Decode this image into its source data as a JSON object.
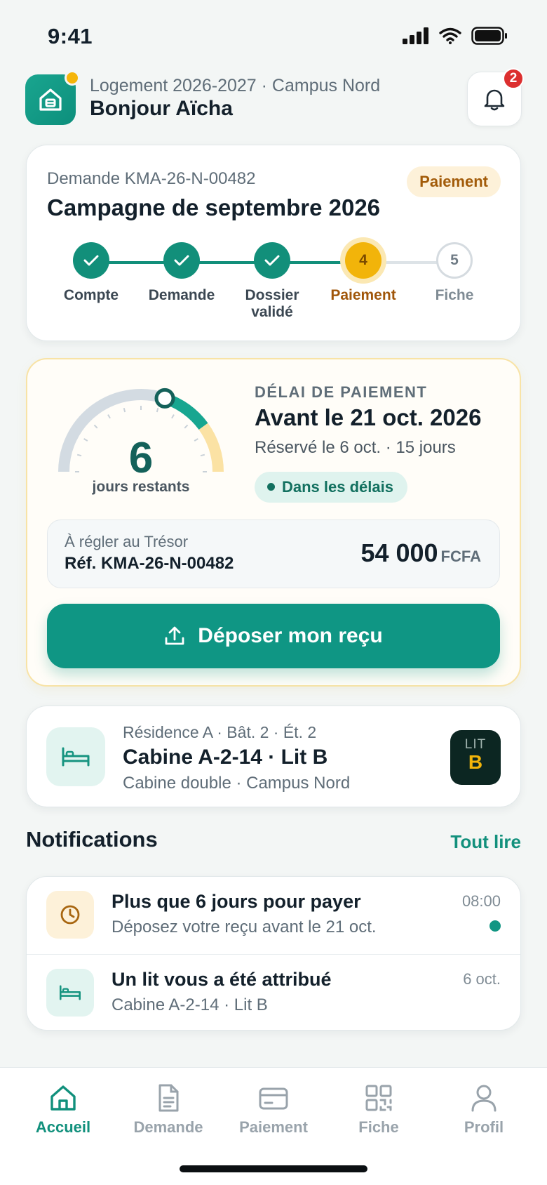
{
  "status_bar": {
    "time": "9:41"
  },
  "header": {
    "subtitle": "Logement 2026-2027 · Campus Nord",
    "greeting": "Bonjour Aïcha",
    "notification_count": "2"
  },
  "request": {
    "id_label": "Demande KMA-26-N-00482",
    "title": "Campagne de septembre 2026",
    "badge": "Paiement",
    "steps": [
      {
        "label": "Compte",
        "state": "done"
      },
      {
        "label": "Demande",
        "state": "done"
      },
      {
        "label": "Dossier validé",
        "state": "done"
      },
      {
        "label": "Paiement",
        "state": "current",
        "number": "4"
      },
      {
        "label": "Fiche",
        "state": "todo",
        "number": "5"
      }
    ]
  },
  "payment": {
    "days_remaining": "6",
    "days_label": "jours restants",
    "days_total": 15,
    "eyebrow": "DÉLAI DE PAIEMENT",
    "deadline": "Avant le 21 oct. 2026",
    "reserved": "Réservé le 6 oct. · 15 jours",
    "status": "Dans les délais",
    "pay_to_label": "À régler au Trésor",
    "reference": "Réf. KMA-26-N-00482",
    "amount": "54 000",
    "currency": "FCFA",
    "upload_button": "Déposer mon reçu"
  },
  "bed": {
    "residence": "Résidence A · Bât. 2 · Ét. 2",
    "title": "Cabine A-2-14 · Lit B",
    "type": "Cabine double · Campus Nord",
    "badge_label": "LIT",
    "badge_letter": "B"
  },
  "notifications": {
    "heading": "Notifications",
    "read_all": "Tout lire",
    "items": [
      {
        "title": "Plus que 6 jours pour payer",
        "text": "Déposez votre reçu avant le 21 oct.",
        "time": "08:00",
        "icon": "clock-icon",
        "unread": true
      },
      {
        "title": "Un lit vous a été attribué",
        "text": "Cabine A-2-14 · Lit B",
        "time": "6 oct.",
        "icon": "bed-icon",
        "unread": false
      }
    ]
  },
  "tabs": [
    {
      "label": "Accueil",
      "icon": "home-icon",
      "active": true
    },
    {
      "label": "Demande",
      "icon": "document-icon",
      "active": false
    },
    {
      "label": "Paiement",
      "icon": "card-icon",
      "active": false
    },
    {
      "label": "Fiche",
      "icon": "qr-code-icon",
      "active": false
    },
    {
      "label": "Profil",
      "icon": "user-icon",
      "active": false
    }
  ],
  "colors": {
    "primary": "#0f9684",
    "accent": "#f2b40a",
    "background": "#f3f6f5",
    "alert": "#dc2f2f"
  }
}
